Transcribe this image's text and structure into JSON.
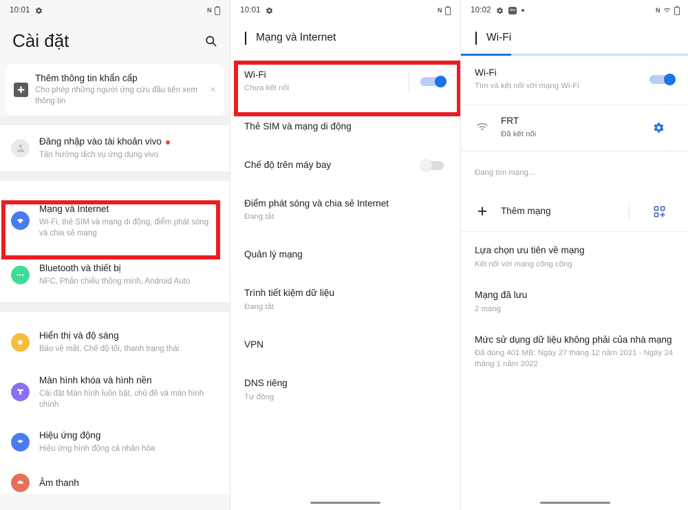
{
  "colors": {
    "accent_blue": "#1a73e8",
    "highlight_red": "#ee1c22",
    "icon_green": "#3ddc97",
    "icon_yellow": "#f7bd3e",
    "icon_purple": "#8c6ff0",
    "icon_blue": "#4a7cf0",
    "icon_orange": "#e8705a",
    "badge_red": "#e8453c"
  },
  "panel_settings": {
    "statusbar": {
      "time": "10:01",
      "left_icons": [
        "gear-icon"
      ],
      "right_icons": [
        "nfc-icon",
        "battery-icon"
      ],
      "nfc_label": "N"
    },
    "page_title": "Cài đặt",
    "search_icon": "search-icon",
    "emergency_card": {
      "icon": "emergency-plus-icon",
      "title": "Thêm thông tin khẩn cấp",
      "subtitle": "Cho phép những người ứng cứu đầu tiên xem thông tin",
      "close_label": "×"
    },
    "account_row": {
      "icon": "account-avatar-icon",
      "title": "Đăng nhập vào tài khoản vivo",
      "subtitle": "Tận hưởng dịch vụ ứng dụng vivo",
      "has_badge": true
    },
    "items": [
      {
        "icon": "network-wifi-icon",
        "title": "Mạng và Internet",
        "subtitle": "Wi-Fi, thẻ SIM và mạng di động, điểm phát sóng và chia sẻ mạng",
        "color": "#4a7cf0",
        "highlighted": true
      },
      {
        "icon": "bluetooth-devices-icon",
        "title": "Bluetooth và thiết bị",
        "subtitle": "NFC, Phản chiếu thông minh, Android Auto",
        "color": "#3ddc97",
        "highlighted": false
      },
      {
        "icon": "display-brightness-icon",
        "title": "Hiển thị và độ sáng",
        "subtitle": "Bảo vệ mắt, Chế độ tối, thanh trạng thái",
        "color": "#f7bd3e",
        "highlighted": false
      },
      {
        "icon": "lockscreen-wallpaper-icon",
        "title": "Màn hình khóa và hình nền",
        "subtitle": "Cài đặt Màn hình luôn bật, chủ đề và màn hình chính",
        "color": "#8c6ff0",
        "highlighted": false
      },
      {
        "icon": "animation-effects-icon",
        "title": "Hiệu ứng động",
        "subtitle": "Hiệu ứng hình động cá nhân hóa",
        "color": "#4a7cf0",
        "highlighted": false
      },
      {
        "icon": "sound-icon",
        "title": "Âm thanh",
        "subtitle": "",
        "color": "#e8705a",
        "highlighted": false
      }
    ]
  },
  "panel_network": {
    "statusbar": {
      "time": "10:01",
      "nfc_label": "N"
    },
    "header_title": "Mạng và Internet",
    "back_icon": "back-chevron-icon",
    "items": [
      {
        "title": "Wi-Fi",
        "subtitle": "Chưa kết nối",
        "toggle": "on",
        "highlighted": true
      },
      {
        "title": "Thẻ SIM và mạng di động",
        "subtitle": "",
        "toggle": null,
        "highlighted": false
      },
      {
        "title": "Chế độ trên máy bay",
        "subtitle": "",
        "toggle": "off",
        "highlighted": false
      },
      {
        "title": "Điểm phát sóng và chia sẻ Internet",
        "subtitle": "Đang tắt",
        "toggle": null,
        "highlighted": false
      },
      {
        "title": "Quản lý mạng",
        "subtitle": "",
        "toggle": null,
        "highlighted": false
      },
      {
        "title": "Trình tiết kiệm dữ liệu",
        "subtitle": "Đang tắt",
        "toggle": null,
        "highlighted": false
      },
      {
        "title": "VPN",
        "subtitle": "",
        "toggle": null,
        "highlighted": false
      },
      {
        "title": "DNS riêng",
        "subtitle": "Tự động",
        "toggle": null,
        "highlighted": false
      }
    ]
  },
  "panel_wifi": {
    "statusbar": {
      "time": "10:02",
      "left_icons": [
        "gear-icon",
        "vivo-app-icon",
        "dot-icon"
      ],
      "right_icons": [
        "nfc-icon",
        "wifi-icon",
        "battery-icon"
      ],
      "nfc_label": "N",
      "vivo_label": "vivo"
    },
    "header_title": "Wi-Fi",
    "back_icon": "back-chevron-icon",
    "loading_progress": 22,
    "wifi_toggle_row": {
      "title": "Wi-Fi",
      "subtitle": "Tìm và kết nối với mạng Wi-Fi",
      "toggle": "on"
    },
    "networks": [
      {
        "icon": "wifi-signal-icon",
        "name": "FRT",
        "status": "Đã kết nối",
        "settings_icon": "gear-icon"
      }
    ],
    "scanning_text": "Đang tìm mạng...",
    "add_network": {
      "plus_icon": "plus-icon",
      "label": "Thêm mạng",
      "qr_icon": "qr-scan-icon"
    },
    "options": [
      {
        "title": "Lựa chọn ưu tiên về mạng",
        "subtitle": "Kết nối với mạng công cộng"
      },
      {
        "title": "Mạng đã lưu",
        "subtitle": "2 mạng"
      },
      {
        "title": "Mức sử dụng dữ liệu không phải của nhà mạng",
        "subtitle": "Đã dùng 401 MB: Ngày 27 tháng 12 năm 2021 - Ngày 24 tháng 1 năm 2022"
      }
    ]
  }
}
